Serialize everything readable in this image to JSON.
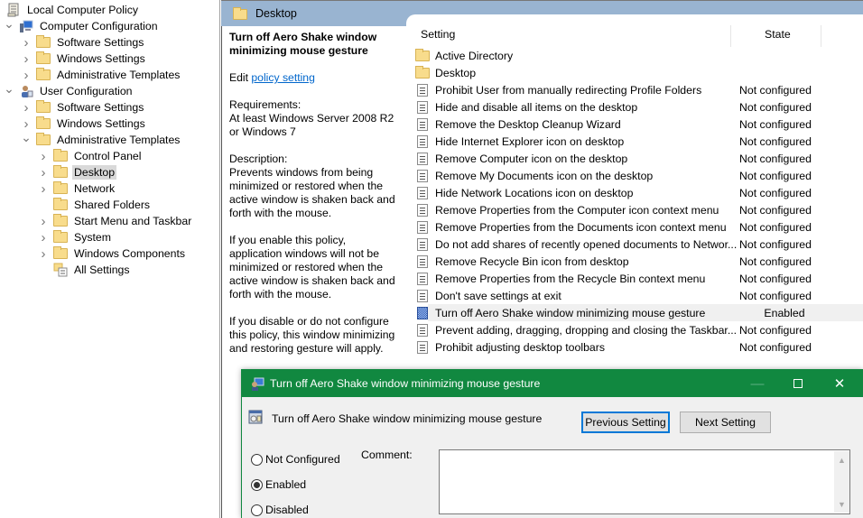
{
  "tree": {
    "root": "Local Computer Policy",
    "items": [
      {
        "label": "Computer Configuration",
        "expanded": true,
        "icon": "computer-config-icon"
      },
      {
        "label": "Software Settings"
      },
      {
        "label": "Windows Settings"
      },
      {
        "label": "Administrative Templates"
      },
      {
        "label": "User Configuration",
        "expanded": true,
        "icon": "user-config-icon"
      },
      {
        "label": "Software Settings"
      },
      {
        "label": "Windows Settings"
      },
      {
        "label": "Administrative Templates",
        "expanded": true
      },
      {
        "label": "Control Panel"
      },
      {
        "label": "Desktop",
        "selected": true
      },
      {
        "label": "Network"
      },
      {
        "label": "Shared Folders"
      },
      {
        "label": "Start Menu and Taskbar"
      },
      {
        "label": "System"
      },
      {
        "label": "Windows Components"
      },
      {
        "label": "All Settings",
        "icon": "all-settings-icon"
      }
    ]
  },
  "header": {
    "title": "Desktop"
  },
  "description": {
    "title": "Turn off Aero Shake window minimizing mouse gesture",
    "edit_prefix": "Edit",
    "edit_link": "policy setting",
    "requirements_label": "Requirements:",
    "requirements": "At least Windows Server 2008 R2 or Windows 7",
    "description_label": "Description:",
    "description": "Prevents windows from being minimized or restored when the active window is shaken back and forth with the mouse.",
    "enable_text": "If you enable this policy, application windows will not be minimized or restored when the active window is shaken back and forth with the mouse.",
    "disable_text": "If you disable or do not configure this policy, this window minimizing and restoring gesture will apply."
  },
  "list": {
    "columns": {
      "setting": "Setting",
      "state": "State"
    },
    "folders": [
      "Active Directory",
      "Desktop"
    ],
    "rows": [
      {
        "name": "Prohibit User from manually redirecting Profile Folders",
        "state": "Not configured"
      },
      {
        "name": "Hide and disable all items on the desktop",
        "state": "Not configured"
      },
      {
        "name": "Remove the Desktop Cleanup Wizard",
        "state": "Not configured"
      },
      {
        "name": "Hide Internet Explorer icon on desktop",
        "state": "Not configured"
      },
      {
        "name": "Remove Computer icon on the desktop",
        "state": "Not configured"
      },
      {
        "name": "Remove My Documents icon on the desktop",
        "state": "Not configured"
      },
      {
        "name": "Hide Network Locations icon on desktop",
        "state": "Not configured"
      },
      {
        "name": "Remove Properties from the Computer icon context menu",
        "state": "Not configured"
      },
      {
        "name": "Remove Properties from the Documents icon context menu",
        "state": "Not configured"
      },
      {
        "name": "Do not add shares of recently opened documents to Networ...",
        "state": "Not configured"
      },
      {
        "name": "Remove Recycle Bin icon from desktop",
        "state": "Not configured"
      },
      {
        "name": "Remove Properties from the Recycle Bin context menu",
        "state": "Not configured"
      },
      {
        "name": "Don't save settings at exit",
        "state": "Not configured"
      },
      {
        "name": "Turn off Aero Shake window minimizing mouse gesture",
        "state": "Enabled",
        "active": true
      },
      {
        "name": "Prevent adding, dragging, dropping and closing the Taskbar...",
        "state": "Not configured"
      },
      {
        "name": "Prohibit adjusting desktop toolbars",
        "state": "Not configured"
      }
    ]
  },
  "dialog": {
    "title": "Turn off Aero Shake window minimizing mouse gesture",
    "subtitle": "Turn off Aero Shake window minimizing mouse gesture",
    "prev_button": "Previous Setting",
    "next_button": "Next Setting",
    "radios": [
      {
        "label": "Not Configured",
        "checked": false
      },
      {
        "label": "Enabled",
        "checked": true
      },
      {
        "label": "Disabled",
        "checked": false
      }
    ],
    "comment_label": "Comment:",
    "comment_value": "",
    "accent_color": "#118840"
  }
}
